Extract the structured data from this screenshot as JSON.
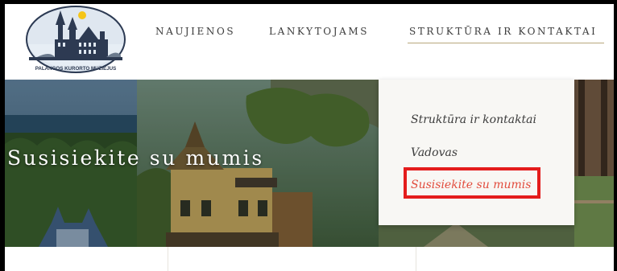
{
  "logo": {
    "caption": "PALANGOS KURORTO MUZIEJUS"
  },
  "nav": {
    "items": [
      "NAUJIENOS",
      "LANKYTOJAMS",
      "STRUKTŪRA IR KONTAKTAI"
    ]
  },
  "hero": {
    "title": "Susisiekite su mumis"
  },
  "dropdown": {
    "items": [
      "Struktūra ir kontaktai",
      "Vadovas",
      "Susisiekite su mumis"
    ]
  },
  "colors": {
    "accent": "#e24c3d",
    "highlight": "#e41c1c",
    "underline": "#b8a77c"
  }
}
